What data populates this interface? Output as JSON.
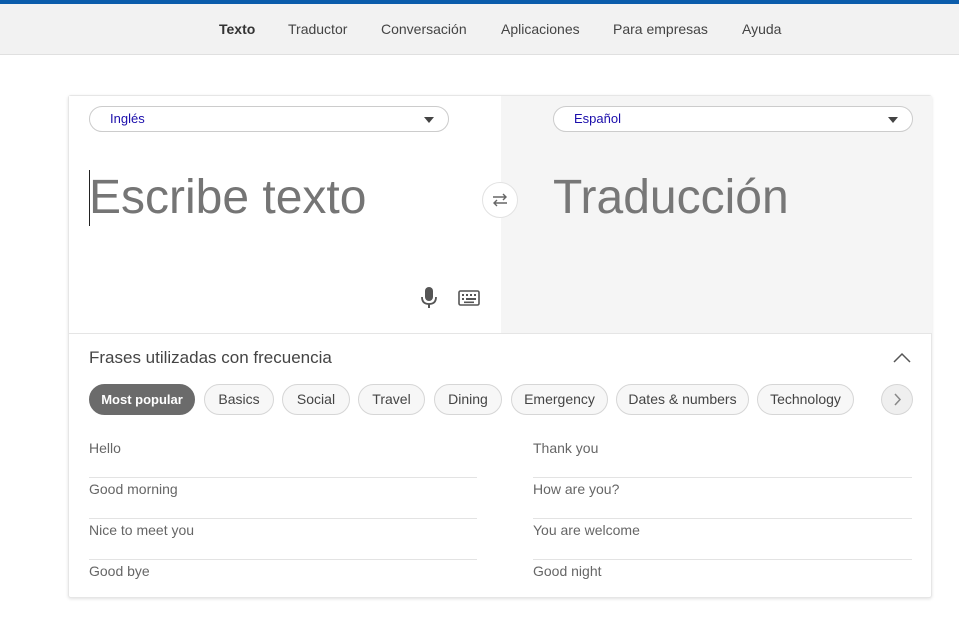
{
  "nav": {
    "items": [
      "Texto",
      "Traductor",
      "Conversación",
      "Aplicaciones",
      "Para empresas",
      "Ayuda"
    ],
    "active": "Texto"
  },
  "translator": {
    "source_lang": "Inglés",
    "target_lang": "Español",
    "source_placeholder": "Escribe texto",
    "target_placeholder": "Traducción"
  },
  "phrases": {
    "title": "Frases utilizadas con frecuencia",
    "categories": [
      "Most popular",
      "Basics",
      "Social",
      "Travel",
      "Dining",
      "Emergency",
      "Dates & numbers",
      "Technology"
    ],
    "active_category": "Most popular",
    "left": [
      "Hello",
      "Good morning",
      "Nice to meet you",
      "Good bye"
    ],
    "right": [
      "Thank you",
      "How are you?",
      "You are welcome",
      "Good night"
    ]
  },
  "colors": {
    "brand_bar": "#0b5cab",
    "active_chip": "#6b6b6b",
    "lang_text": "#1a0dab"
  },
  "icons": [
    "swap-icon",
    "microphone-icon",
    "keyboard-icon",
    "chevron-up-icon",
    "chevron-right-icon",
    "caret-down-icon"
  ]
}
